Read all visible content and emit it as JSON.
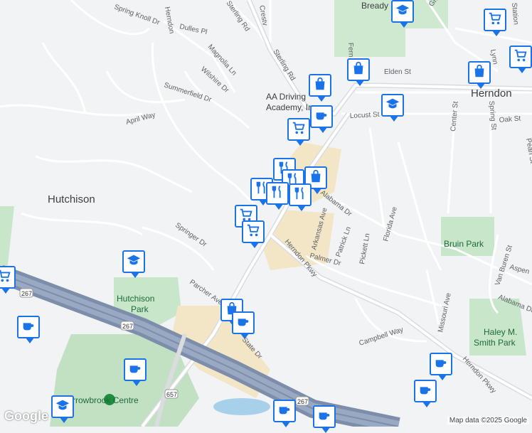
{
  "streets": [
    {
      "text": "Spring Knoll Dr"
    },
    {
      "text": "Herndon"
    },
    {
      "text": "Sterling Rd"
    },
    {
      "text": "Crestv"
    },
    {
      "text": "Dulles Pl"
    },
    {
      "text": "Magnolia Ln"
    },
    {
      "text": "Wilshire Dr"
    },
    {
      "text": "Summerfield Dr"
    },
    {
      "text": "April Way"
    },
    {
      "text": "Springer Dr"
    },
    {
      "text": "Parcher Ave"
    },
    {
      "text": "Arkansas Ave"
    },
    {
      "text": "Patrick Ln"
    },
    {
      "text": "Pickett Ln"
    },
    {
      "text": "Florida Ave"
    },
    {
      "text": "Palmer Dr"
    },
    {
      "text": "Herndon Pkwy"
    },
    {
      "text": "Alabama Dr"
    },
    {
      "text": "Campbell Way"
    },
    {
      "text": "Missouri Ave"
    },
    {
      "text": "Van Buren St"
    },
    {
      "text": "Center St"
    },
    {
      "text": "Spring St"
    },
    {
      "text": "Oak St"
    },
    {
      "text": "Locust St"
    },
    {
      "text": "Grace"
    },
    {
      "text": "Station"
    },
    {
      "text": "Lynn"
    },
    {
      "text": "Pearl St"
    },
    {
      "text": "Fern"
    },
    {
      "text": "Sterling Rd"
    },
    {
      "text": "Elden St"
    },
    {
      "text": "Aspen"
    },
    {
      "text": "Alabama Dr"
    },
    {
      "text": "Herndon Pkwy"
    },
    {
      "text": "Herndon Pkwy"
    },
    {
      "text": "State Dr"
    }
  ],
  "places": {
    "hutchison": "Hutchison",
    "herndon": "Herndon",
    "hutchison_park_1": "Hutchison",
    "hutchison_park_2": "Park",
    "bruin_park": "Bruin Park",
    "haley_1": "Haley M.",
    "haley_2": "Smith Park",
    "academy_1": "AA Driving",
    "academy_2": "Academy, Inc",
    "bready": "Bready",
    "arrowbrook": "Arrowbrook Centre"
  },
  "shields": [
    "267",
    "267",
    "657",
    "267"
  ],
  "pois": [
    {
      "icon": "school-icon"
    },
    {
      "icon": "coffee-icon"
    },
    {
      "icon": "shopping-bag-icon"
    },
    {
      "icon": "shopping-cart-icon"
    },
    {
      "icon": "shopping-bag-icon"
    },
    {
      "icon": "school-icon"
    },
    {
      "icon": "shopping-bag-icon"
    },
    {
      "icon": "coffee-icon"
    },
    {
      "icon": "shopping-cart-icon"
    },
    {
      "icon": "restaurant-icon"
    },
    {
      "icon": "restaurant-icon"
    },
    {
      "icon": "restaurant-icon"
    },
    {
      "icon": "restaurant-icon"
    },
    {
      "icon": "restaurant-icon"
    },
    {
      "icon": "shopping-bag-icon"
    },
    {
      "icon": "restaurant-icon"
    },
    {
      "icon": "shopping-cart-icon"
    },
    {
      "icon": "shopping-cart-icon"
    },
    {
      "icon": "school-icon"
    },
    {
      "icon": "shopping-bag-icon"
    },
    {
      "icon": "coffee-icon"
    },
    {
      "icon": "coffee-icon"
    },
    {
      "icon": "coffee-icon"
    },
    {
      "icon": "coffee-icon"
    },
    {
      "icon": "coffee-icon"
    },
    {
      "icon": "school-icon"
    },
    {
      "icon": "coffee-icon"
    },
    {
      "icon": "coffee-icon"
    },
    {
      "icon": "shopping-cart-icon"
    }
  ],
  "branding": {
    "logo": "Google",
    "attribution": "Map data ©2025 Google"
  },
  "colors": {
    "pin_border": "#1a73e8",
    "park": "#c8e6c9",
    "highway": "#8a9bb8",
    "commercial": "#f3e6c6",
    "water": "#a7d0ea"
  }
}
